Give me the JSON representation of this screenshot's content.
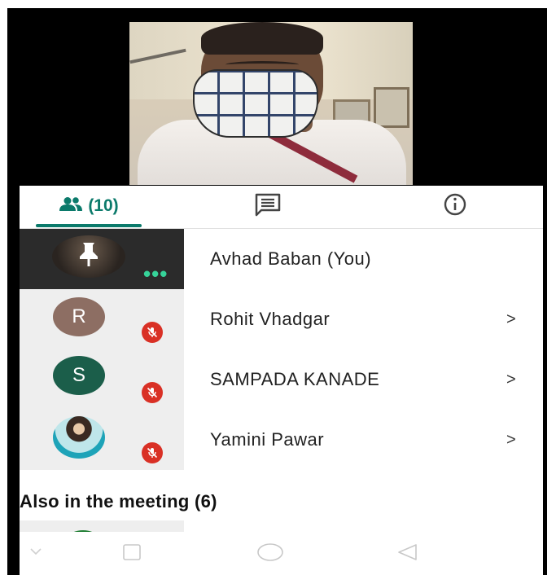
{
  "tabs": {
    "people": {
      "icon": "people-icon",
      "label": "(10)"
    },
    "chat": {
      "icon": "chat-icon"
    },
    "info": {
      "icon": "info-icon"
    },
    "active_color": "#0b7a6b"
  },
  "participants": [
    {
      "name": "Avhad Baban (You)",
      "avatar_type": "video",
      "muted": false,
      "more_options": "•••",
      "has_chevron": false
    },
    {
      "name": "Rohit Vhadgar",
      "initial": "R",
      "avatar_color": "#8d6e63",
      "muted": true,
      "chevron": ">"
    },
    {
      "name": "SAMPADA KANADE",
      "initial": "S",
      "avatar_color": "#1b5e4a",
      "muted": true,
      "chevron": ">"
    },
    {
      "name": "Yamini Pawar",
      "avatar_type": "photo",
      "muted": true,
      "chevron": ">"
    }
  ],
  "also_in_meeting": {
    "title": "Also in the meeting (6)"
  },
  "mute_color": "#d93025",
  "navbar": {
    "icons": [
      "back-icon",
      "recents-icon",
      "home-icon",
      "back-triangle-icon"
    ]
  }
}
